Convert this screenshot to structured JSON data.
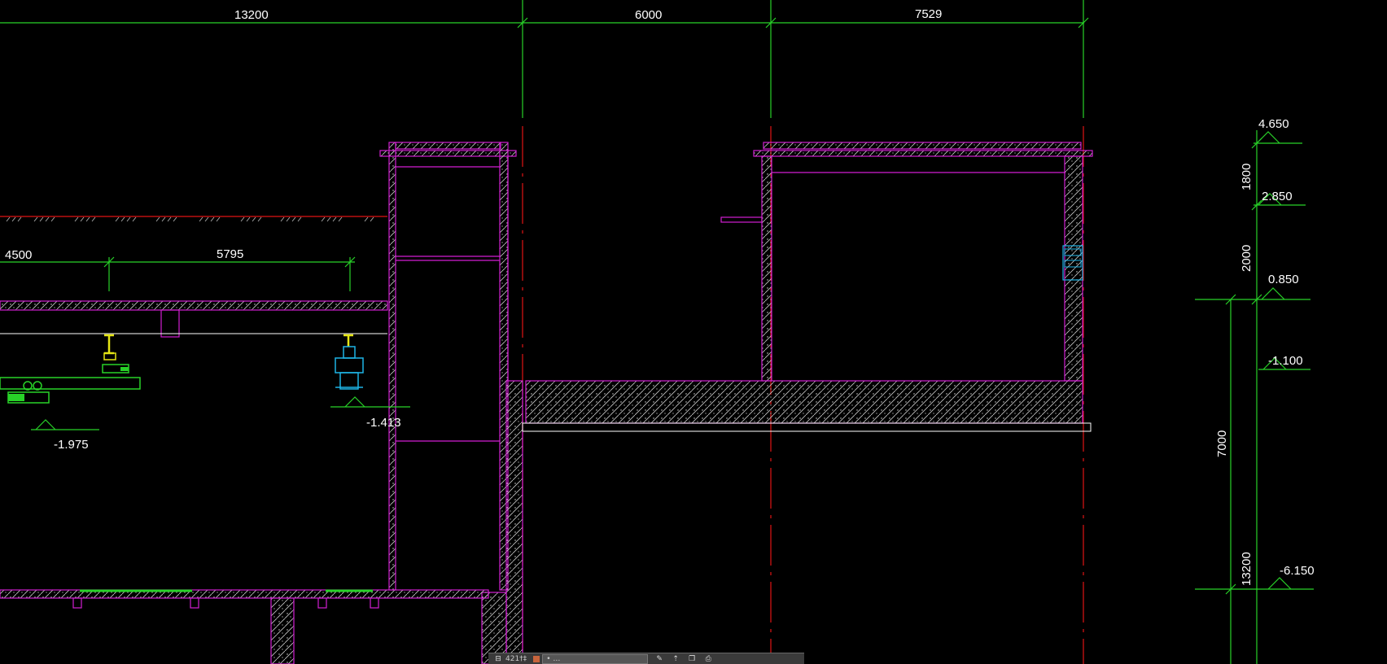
{
  "dimensions": {
    "top": [
      "13200",
      "6000",
      "7529"
    ],
    "mid": [
      "4500",
      "5795"
    ],
    "right_vertical": [
      "1800",
      "2000",
      "7000",
      "13200"
    ]
  },
  "levels": [
    "4.650",
    "2.850",
    "0.850",
    "-1.100",
    "-6.150",
    "-1.975",
    "-1.4​13"
  ],
  "status_bar": {
    "left_label": "421†‡",
    "field_text": "• …",
    "icons": [
      "pen-icon",
      "pointer-icon",
      "copy-icon",
      "print-icon"
    ]
  },
  "colors": {
    "structure": "#d21ed2",
    "dimension": "#28d228",
    "axis": "#e01414",
    "equipment_yellow": "#e6e614",
    "equipment_cyan": "#1eb4e6",
    "white": "#ffffff"
  }
}
